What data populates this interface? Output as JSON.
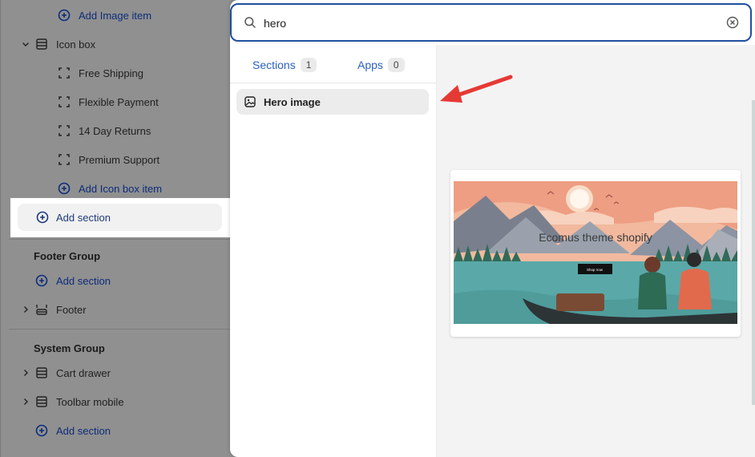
{
  "sidebar": {
    "add_image_item": "Add Image item",
    "icon_box": {
      "label": "Icon box",
      "items": [
        "Free Shipping",
        "Flexible Payment",
        "14 Day Returns",
        "Premium Support"
      ],
      "add_label": "Add Icon box item"
    },
    "add_section_highlighted": "Add section",
    "footer_group": {
      "heading": "Footer Group",
      "add_label": "Add section",
      "items": [
        "Footer"
      ]
    },
    "system_group": {
      "heading": "System Group",
      "items": [
        "Cart drawer",
        "Toolbar mobile"
      ],
      "add_label": "Add section"
    }
  },
  "search": {
    "value": "hero",
    "tabs": [
      {
        "label": "Sections",
        "count": "1"
      },
      {
        "label": "Apps",
        "count": "0"
      }
    ],
    "results": [
      {
        "label": "Hero image",
        "icon": "image-icon"
      }
    ]
  },
  "preview": {
    "heading": "Ecomus theme shopify",
    "button_label": "Shop now",
    "colors": {
      "sky": "#f0b49a",
      "water": "#5aa9a8",
      "sun": "#fff3e6"
    }
  },
  "colors": {
    "accent": "#1f4fa0",
    "tab_text": "#2b62c0",
    "arrow": "#e53935"
  }
}
